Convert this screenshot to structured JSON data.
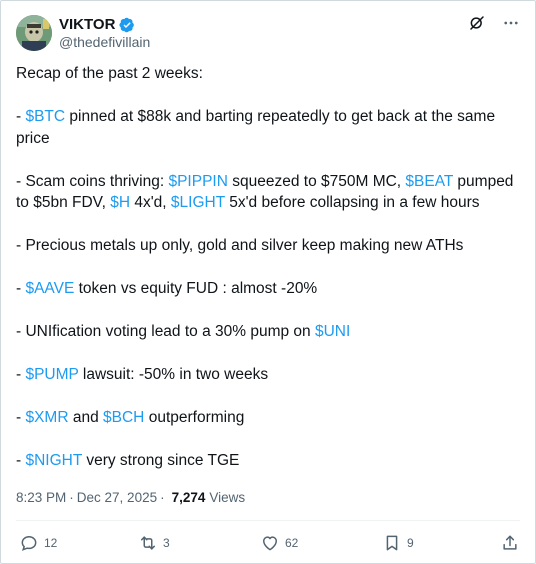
{
  "author": {
    "display_name": "VIKTOR",
    "handle": "@thedefivillain",
    "verified": true,
    "avatar_icon": "avatar-image"
  },
  "tweet": {
    "intro": "Recap of the past 2 weeks:",
    "item_btc": {
      "prefix": "- ",
      "tag": "$BTC",
      "rest": " pinned at $88k and barting repeatedly to get back at the same price"
    },
    "item_scam": {
      "prefix": "- Scam coins thriving: ",
      "tag1": "$PIPPIN",
      "text1": " squeezed to $750M MC, ",
      "tag2": "$BEAT",
      "text2": " pumped to $5bn FDV, ",
      "tag3": "$H",
      "text3": " 4x'd, ",
      "tag4": "$LIGHT",
      "text4": " 5x'd before collapsing in a few hours"
    },
    "item_metals": "- Precious metals up only, gold and silver keep making new ATHs",
    "item_aave": {
      "prefix": "- ",
      "tag": "$AAVE",
      "rest": " token vs equity FUD : almost -20%"
    },
    "item_uni": {
      "prefix": "- UNIfication voting lead to a 30% pump on ",
      "tag": "$UNI"
    },
    "item_pump": {
      "prefix": "- ",
      "tag": "$PUMP",
      "rest": " lawsuit: -50% in two weeks"
    },
    "item_xmr": {
      "prefix": "- ",
      "tag1": "$XMR",
      "mid": " and ",
      "tag2": "$BCH",
      "rest": " outperforming"
    },
    "item_night": {
      "prefix": "- ",
      "tag": "$NIGHT",
      "rest": " very strong since TGE"
    }
  },
  "meta": {
    "time": "8:23 PM",
    "separator": "·",
    "date": "Dec 27, 2025",
    "views_count": "7,274",
    "views_label": "Views"
  },
  "actions": {
    "replies": "12",
    "reposts": "3",
    "likes": "62",
    "bookmarks": "9"
  },
  "colors": {
    "accent": "#1d9bf0",
    "text": "#0f1419",
    "muted": "#536471"
  }
}
